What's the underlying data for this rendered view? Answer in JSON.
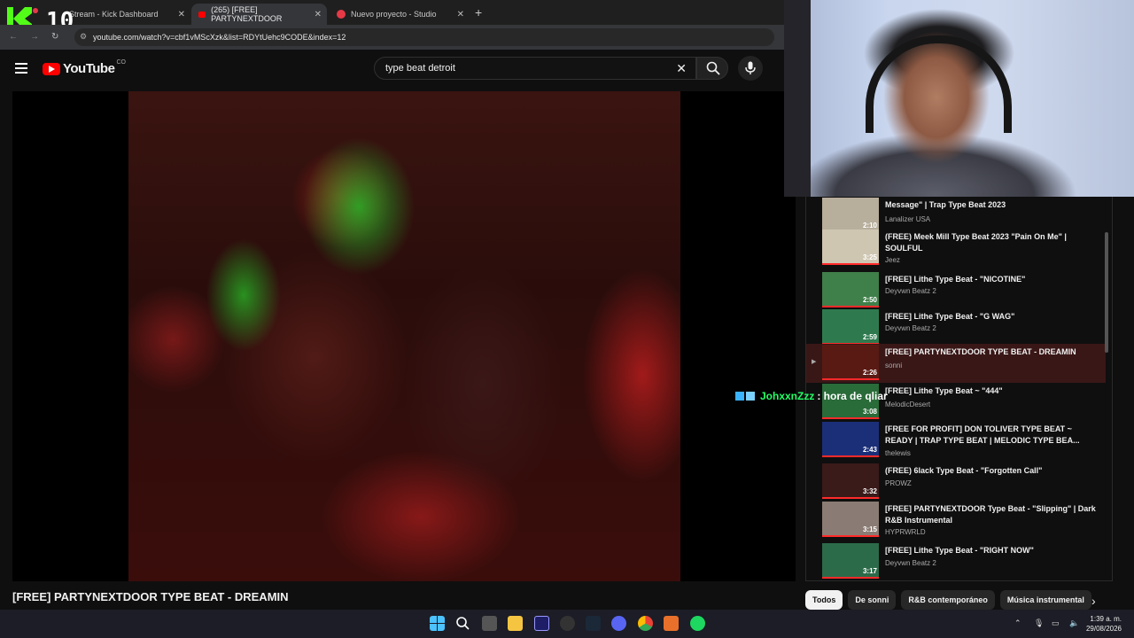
{
  "browser": {
    "tabs": [
      {
        "label": "Stream - Kick Dashboard",
        "active": false
      },
      {
        "label": "(265) [FREE] PARTYNEXTDOOR",
        "active": true
      },
      {
        "label": "Nuevo proyecto - Studio",
        "active": false
      }
    ],
    "overlay_counter": "10",
    "url": "youtube.com/watch?v=cbf1vMScXzk&list=RDYtUehc9CODE&index=12"
  },
  "youtube": {
    "logo_text": "YouTube",
    "logo_suffix": "CO",
    "search_query": "type beat detroit"
  },
  "video": {
    "title": "[FREE] PARTYNEXTDOOR TYPE BEAT - DREAMIN"
  },
  "chat": {
    "user": "JohxxnZzz",
    "message": ": hora de qliar"
  },
  "playlist": [
    {
      "title": "Message\" | Trap Type Beat 2023",
      "channel": "Lanalizer USA",
      "duration": "2:10",
      "current": false
    },
    {
      "title": "(FREE) Meek Mill Type Beat 2023 \"Pain On Me\" | SOULFUL",
      "channel": "Jeez",
      "duration": "3:25",
      "current": false
    },
    {
      "title": "[FREE] Lithe Type Beat - \"NICOTINE\"",
      "channel": "Deyvwn Beatz 2",
      "duration": "2:50",
      "current": false
    },
    {
      "title": "[FREE] Lithe Type Beat - \"G WAG\"",
      "channel": "Deyvwn Beatz 2",
      "duration": "2:59",
      "current": false
    },
    {
      "title": "[FREE] PARTYNEXTDOOR TYPE BEAT - DREAMIN",
      "channel": "sonni",
      "duration": "2:26",
      "current": true
    },
    {
      "title": "[FREE] Lithe Type Beat ~ \"444\"",
      "channel": "MelodicDesert",
      "duration": "3:08",
      "current": false
    },
    {
      "title": "[FREE FOR PROFIT] DON TOLIVER TYPE BEAT ~ READY | TRAP TYPE BEAT | MELODIC TYPE BEA...",
      "channel": "thelewis",
      "duration": "2:43",
      "current": false
    },
    {
      "title": "(FREE) 6lack Type Beat - \"Forgotten Call\"",
      "channel": "PROWZ",
      "duration": "3:32",
      "current": false
    },
    {
      "title": "[FREE] PARTYNEXTDOOR Type Beat - \"Slipping\" | Dark R&B Instrumental",
      "channel": "HYPRWRLD",
      "duration": "3:15",
      "current": false
    },
    {
      "title": "[FREE] Lithe Type Beat - \"RIGHT NOW\"",
      "channel": "Deyvwn Beatz 2",
      "duration": "3:17",
      "current": false
    }
  ],
  "chips": [
    "Todos",
    "De sonni",
    "R&B contemporáneo",
    "Música instrumental"
  ],
  "taskbar": {
    "time": "1:39 a. m.",
    "date": "29/08/2026"
  },
  "colors": {
    "yt_red": "#ff0000",
    "chat_user": "#22ff66",
    "background": "#0f0f0f"
  }
}
